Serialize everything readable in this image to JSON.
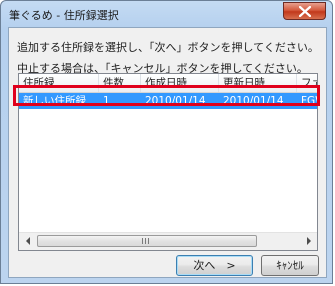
{
  "window": {
    "title": "筆ぐるめ - 住所録選択"
  },
  "icons": {
    "close": "close-icon",
    "scroll_left": "scroll-left-arrow-icon",
    "scroll_right": "scroll-right-arrow-icon"
  },
  "messages": {
    "line1": "追加する住所録を選択し、「次へ」ボタンを押してください。",
    "line2": "中止する場合は、「キャンセル」ボタンを押してください。"
  },
  "list": {
    "columns": [
      "住所録",
      "件数",
      "作成日時",
      "更新日時",
      "ファー"
    ],
    "rows": [
      [
        "新しい住所録",
        "1",
        "2010/01/14",
        "2010/01/14",
        "FGW"
      ]
    ]
  },
  "buttons": {
    "next": "次へ　>",
    "cancel": "ｷｬﾝｾﾙ"
  },
  "colors": {
    "selection": "#3399ff",
    "highlight_frame": "#e0001c"
  }
}
